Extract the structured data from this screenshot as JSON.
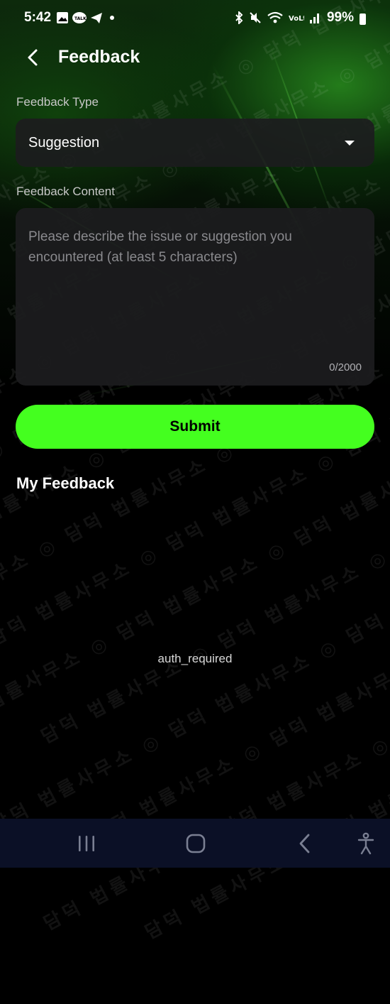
{
  "status_bar": {
    "time": "5:42",
    "battery": "99%",
    "left_icons": [
      "gallery-icon",
      "talk-icon",
      "telegram-icon",
      "dot-icon"
    ],
    "right_icons": [
      "bluetooth-icon",
      "mute-icon",
      "wifi-icon",
      "volte-icon",
      "signal-icon",
      "battery-icon"
    ]
  },
  "header": {
    "title": "Feedback"
  },
  "form": {
    "type_label": "Feedback Type",
    "type_value": "Suggestion",
    "content_label": "Feedback Content",
    "content_placeholder": "Please describe the issue or suggestion you encountered (at least 5 characters)",
    "counter": "0/2000",
    "submit_label": "Submit"
  },
  "my_feedback": {
    "title": "My Feedback",
    "empty_text": "auth_required"
  },
  "watermark_text": "담덕 법률사무소",
  "colors": {
    "accent": "#44ff1f",
    "surface": "#1c1c1e",
    "navbar": "#0b1026"
  }
}
